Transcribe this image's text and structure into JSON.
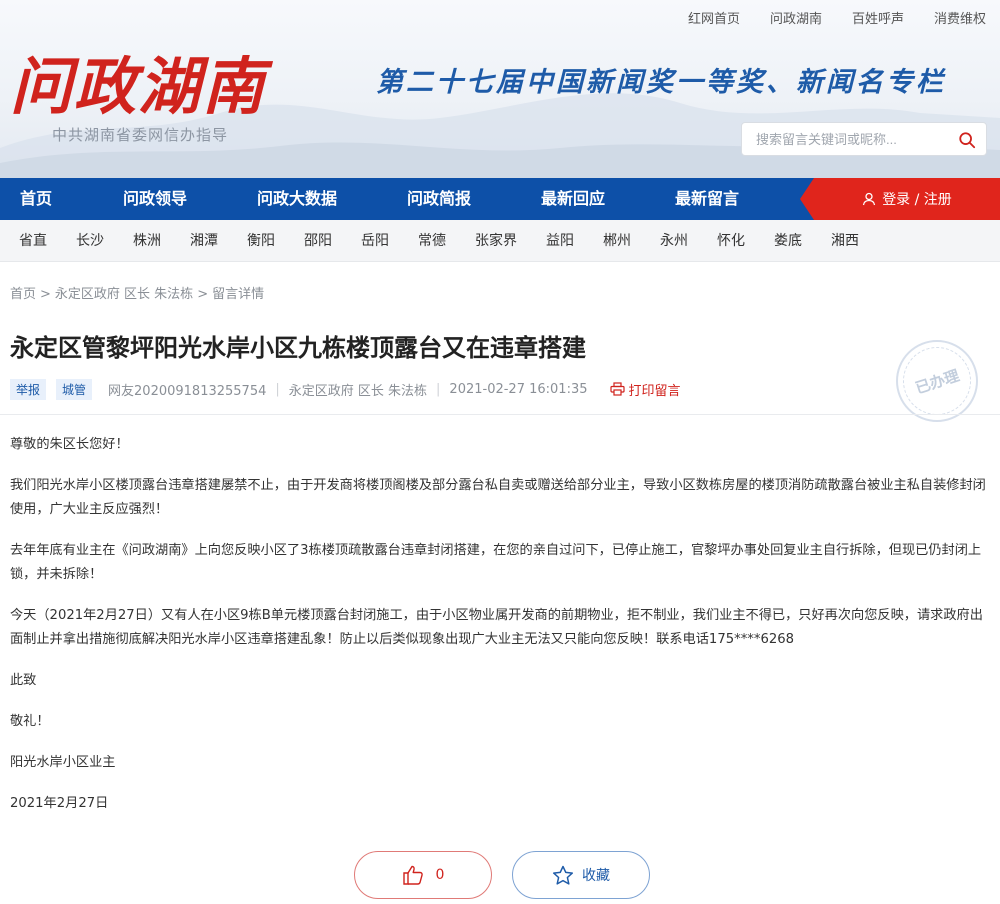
{
  "top_links": [
    "红网首页",
    "问政湖南",
    "百姓呼声",
    "消费维权"
  ],
  "logo": {
    "title": "问政湖南",
    "subtitle": "中共湖南省委网信办指导"
  },
  "slogan": "第二十七届中国新闻奖一等奖、新闻名专栏",
  "search": {
    "placeholder": "搜索留言关键词或昵称..."
  },
  "nav": {
    "items": [
      "首页",
      "问政领导",
      "问政大数据",
      "问政简报",
      "最新回应",
      "最新留言"
    ],
    "login_label": "登录 / 注册"
  },
  "regions": [
    "省直",
    "长沙",
    "株洲",
    "湘潭",
    "衡阳",
    "邵阳",
    "岳阳",
    "常德",
    "张家界",
    "益阳",
    "郴州",
    "永州",
    "怀化",
    "娄底",
    "湘西"
  ],
  "breadcrumb": [
    "首页",
    "永定区政府 区长 朱法栋",
    "留言详情"
  ],
  "post": {
    "title": "永定区管黎坪阳光水岸小区九栋楼顶露台又在违章搭建",
    "tags": [
      "举报",
      "城管"
    ],
    "author": "网友2020091813255754",
    "target": "永定区政府 区长 朱法栋",
    "datetime": "2021-02-27 16:01:35",
    "print_label": "打印留言",
    "stamp": "已办理",
    "paragraphs": [
      "尊敬的朱区长您好！",
      "我们阳光水岸小区楼顶露台违章搭建屡禁不止，由于开发商将楼顶阁楼及部分露台私自卖或赠送给部分业主，导致小区数栋房屋的楼顶消防疏散露台被业主私自装修封闭使用，广大业主反应强烈！",
      "去年年底有业主在《问政湖南》上向您反映小区了3栋楼顶疏散露台违章封闭搭建，在您的亲自过问下，已停止施工，官黎坪办事处回复业主自行拆除，但现已仍封闭上锁，并未拆除！",
      "今天（2021年2月27日）又有人在小区9栋B单元楼顶露台封闭施工，由于小区物业属开发商的前期物业，拒不制业，我们业主不得已，只好再次向您反映，请求政府出面制止并拿出措施彻底解决阳光水岸小区违章搭建乱象！防止以后类似现象出现广大业主无法又只能向您反映！联系电话175****6268",
      "此致",
      "敬礼！",
      "阳光水岸小区业主",
      "2021年2月27日"
    ]
  },
  "actions": {
    "like_count": "0",
    "favorite_label": "收藏"
  },
  "colors": {
    "brand_red": "#d0231d",
    "nav_blue": "#0d50a8",
    "link_blue": "#1e5ba8"
  }
}
